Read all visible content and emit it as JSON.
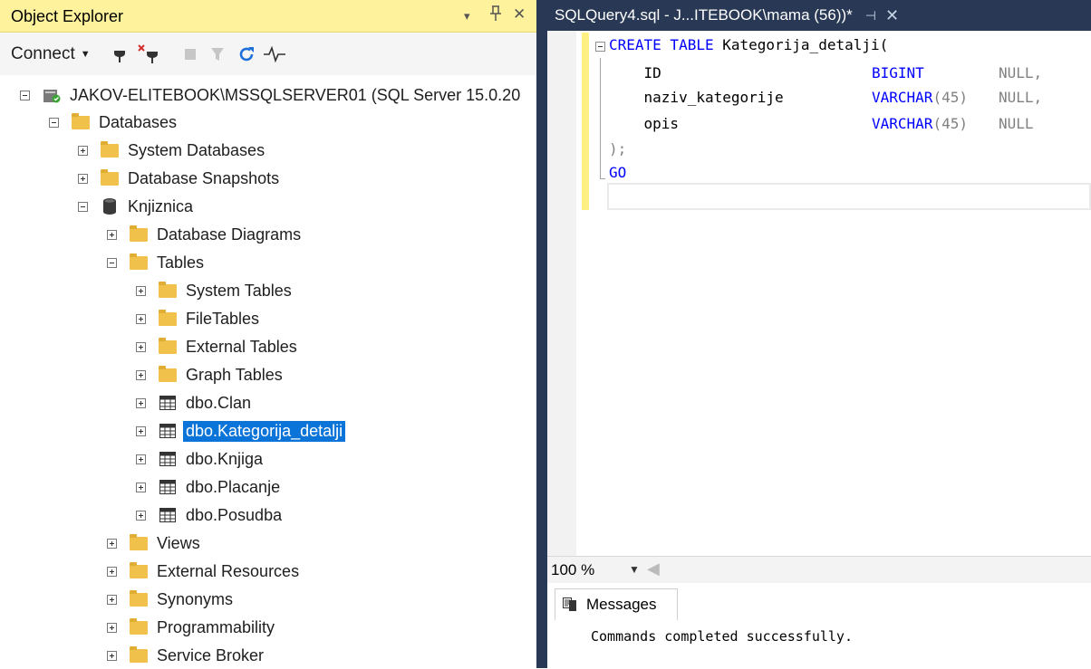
{
  "object_explorer": {
    "title": "Object Explorer",
    "header_buttons": {
      "dropdown": "▾",
      "pin": "ᅲ",
      "close": "✕"
    },
    "toolbar": {
      "connect_label": "Connect"
    }
  },
  "tree": {
    "server": "JAKOV-ELITEBOOK\\MSSQLSERVER01 (SQL Server 15.0.20",
    "databases": "Databases",
    "system_databases": "System Databases",
    "database_snapshots": "Database Snapshots",
    "knjiznica": "Knjiznica",
    "database_diagrams": "Database Diagrams",
    "tables": "Tables",
    "system_tables": "System Tables",
    "filetables": "FileTables",
    "external_tables": "External Tables",
    "graph_tables": "Graph Tables",
    "table_clan": "dbo.Clan",
    "table_kategorija": "dbo.Kategorija_detalji",
    "table_knjiga": "dbo.Knjiga",
    "table_placanje": "dbo.Placanje",
    "table_posudba": "dbo.Posudba",
    "views": "Views",
    "external_resources": "External Resources",
    "synonyms": "Synonyms",
    "programmability": "Programmability",
    "service_broker": "Service Broker"
  },
  "editor": {
    "tab_title": "SQLQuery4.sql - J...ITEBOOK\\mama (56))*",
    "code": {
      "line1_kw": "CREATE TABLE",
      "line1_rest": " Kategorija_detalji(",
      "line2_name": "    ID",
      "line2_type": "BIGINT",
      "line2_null": "NULL,",
      "line3_name": "    naziv_kategorije",
      "line3_type": "VARCHAR",
      "line3_paren": "(45)",
      "line3_null": "NULL,",
      "line4_name": "    opis",
      "line4_type": "VARCHAR",
      "line4_paren": "(45)",
      "line4_null": "NULL",
      "line5": ");",
      "line6": "GO"
    },
    "zoom": "100 %"
  },
  "results": {
    "tab_label": "Messages",
    "message": "Commands completed successfully."
  },
  "colors": {
    "title_bar": "#fff29d",
    "tab_bar": "#293955",
    "selection": "#0a74d8",
    "keyword": "#0000ff",
    "null_keyword": "#808080"
  }
}
